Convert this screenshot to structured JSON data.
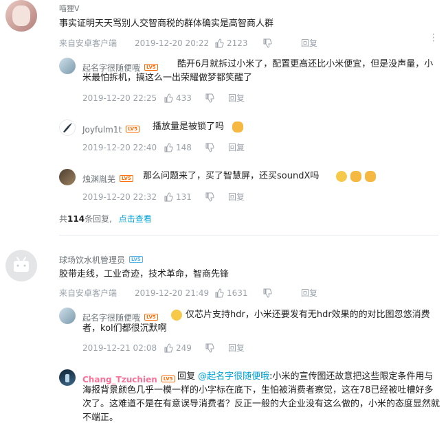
{
  "comments": [
    {
      "user": "喵狸V",
      "text": "事实证明天天骂别人交智商税的群体确实是高智商人群",
      "source": "来自安卓客户端",
      "time": "2019-12-20 20:22",
      "likes": "2123",
      "reply_label": "回复",
      "replies": [
        {
          "user": "起名字很随便哦",
          "level": "LV5",
          "text": "酷开6月就拆过小米了，配置更高还比小米便宜，但是没声量，小米最怕拆机，搞这么一出荣耀做梦都笑醒了",
          "time": "2019-12-20 22:25",
          "likes": "433",
          "reply_label": "回复"
        },
        {
          "user": "Joyfulm1t",
          "level": "LV5",
          "text": "播放量是被锁了吗",
          "time": "2019-12-20 22:40",
          "likes": "148",
          "reply_label": "回复"
        },
        {
          "user": "烛渊胤芜",
          "level": "LV5",
          "text": "那么问题来了，买了智慧屏，还买soundX吗",
          "time": "2019-12-20 22:32",
          "likes": "131",
          "reply_label": "回复"
        }
      ],
      "more_prefix": "共",
      "more_count": "114",
      "more_suffix": "条回复,",
      "more_link": "点击查看"
    },
    {
      "user": "球场饮水机管理员",
      "level": "LV5",
      "text": "胶带走线，工业奇迹，技术革命，智商先锋",
      "source": "来自安卓客户端",
      "time": "2019-12-20 21:49",
      "likes": "1631",
      "reply_label": "回复",
      "replies": [
        {
          "user": "起名字很随便哦",
          "level": "LV5",
          "text": "仅芯片支持hdr，小米还要发有无hdr效果的的对比图忽悠消费者，kol们都很沉默啊",
          "time": "2019-12-21 02:08",
          "likes": "249",
          "reply_label": "回复"
        },
        {
          "user": "Chang_Tzuchien",
          "level": "LV5",
          "reply_prefix": "回复",
          "mention": "@起名字很随便哦",
          "text": ":小米的宣传图还故意把这些限定条件用与海报背景颜色几乎一模一样的小字标在底下，生怕被消费者察觉，这在78已经被吐槽好多次了。这难道不是在有意误导消费者？反正一般的大企业没有这么做的，小米的态度显然就不端正。"
        }
      ]
    }
  ],
  "colors": {
    "accent": "#00a1d6",
    "vip": "#fb7299",
    "meta": "#99a2aa"
  },
  "icons": [
    "like-icon",
    "dislike-icon",
    "more-dots-icon"
  ]
}
